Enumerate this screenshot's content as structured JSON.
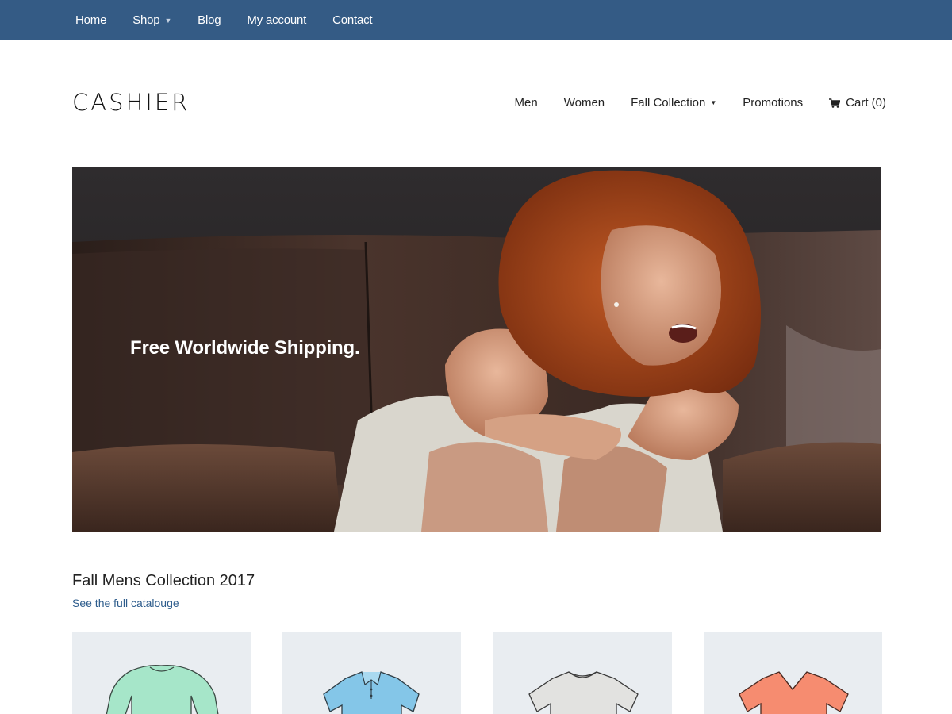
{
  "topbar": {
    "items": [
      {
        "label": "Home"
      },
      {
        "label": "Shop",
        "has_dropdown": true
      },
      {
        "label": "Blog"
      },
      {
        "label": "My account"
      },
      {
        "label": "Contact"
      }
    ],
    "background": "#345b85"
  },
  "header": {
    "logo": "CASHIER",
    "nav": [
      {
        "label": "Men"
      },
      {
        "label": "Women"
      },
      {
        "label": "Fall Collection",
        "has_dropdown": true
      },
      {
        "label": "Promotions"
      }
    ],
    "cart_label": "Cart (0)"
  },
  "hero": {
    "headline": "Free Worldwide Shipping."
  },
  "collection": {
    "title": "Fall Mens Collection 2017",
    "link": "See the full catalouge",
    "products": [
      {
        "name": "green-sweater",
        "color": "#9fe0c4"
      },
      {
        "name": "blue-polo",
        "color": "#7fc3e6"
      },
      {
        "name": "grey-tshirt",
        "color": "#e2e2e0"
      },
      {
        "name": "coral-vneck",
        "color": "#f58a6e"
      }
    ]
  },
  "icons": {
    "cart": "cart-icon",
    "caret": "caret-down-icon"
  }
}
